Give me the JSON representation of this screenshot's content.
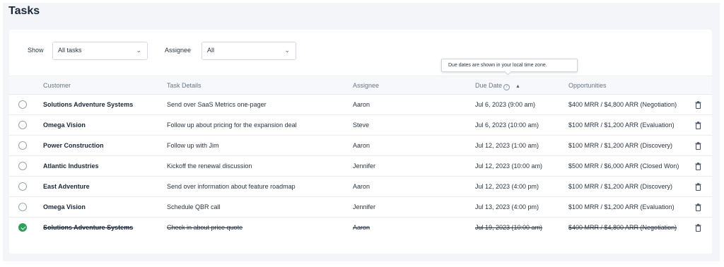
{
  "page": {
    "title": "Tasks"
  },
  "filters": {
    "show_label": "Show",
    "show_value": "All tasks",
    "assignee_label": "Assignee",
    "assignee_value": "All"
  },
  "tooltip": {
    "text": "Due dates are shown in your local time zone."
  },
  "table": {
    "columns": {
      "customer": "Customer",
      "task": "Task Details",
      "assignee": "Assignee",
      "due": "Due Date",
      "opps": "Opportunities"
    },
    "rows": [
      {
        "customer": "Solutions Adventure Systems",
        "task": "Send over SaaS Metrics one-pager",
        "assignee": "Aaron",
        "due": "Jul 6, 2023 (9:00 am)",
        "opps": "$400 MRR / $4,800 ARR (Negotiation)",
        "done": false
      },
      {
        "customer": "Omega Vision",
        "task": "Follow up about pricing for the expansion deal",
        "assignee": "Steve",
        "due": "Jul 6, 2023 (10:00 am)",
        "opps": "$100 MRR / $1,200 ARR (Evaluation)",
        "done": false
      },
      {
        "customer": "Power Construction",
        "task": "Follow up with Jim",
        "assignee": "Aaron",
        "due": "Jul 12, 2023 (1:00 am)",
        "opps": "$100 MRR / $1,200 ARR (Discovery)",
        "done": false
      },
      {
        "customer": "Atlantic Industries",
        "task": "Kickoff the renewal discussion",
        "assignee": "Jennifer",
        "due": "Jul 12, 2023 (10:00 am)",
        "opps": "$500 MRR / $6,000 ARR (Closed Won)",
        "done": false
      },
      {
        "customer": "East Adventure",
        "task": "Send over information about feature roadmap",
        "assignee": "Aaron",
        "due": "Jul 12, 2023 (4:00 pm)",
        "opps": "$100 MRR / $1,200 ARR (Discovery)",
        "done": false
      },
      {
        "customer": "Omega Vision",
        "task": "Schedule QBR call",
        "assignee": "Jennifer",
        "due": "Jul 13, 2023 (4:00 pm)",
        "opps": "$100 MRR / $1,200 ARR (Evaluation)",
        "done": false
      },
      {
        "customer": "Solutions Adventure Systems",
        "task": "Check in about price quote",
        "assignee": "Aaron",
        "due": "Jul 19, 2023 (10:00 am)",
        "opps": "$400 MRR / $4,800 ARR (Negotiation)",
        "done": true
      }
    ]
  },
  "icons": {
    "select_chevron": "chevron-down-icon",
    "due_help": "question-circle-icon",
    "sort": "sort-up-icon",
    "delete": "trash-icon",
    "complete": "check-circle-icon"
  },
  "colors": {
    "completed": "#2e9e5b",
    "page_bg": "#f3f5f9"
  }
}
